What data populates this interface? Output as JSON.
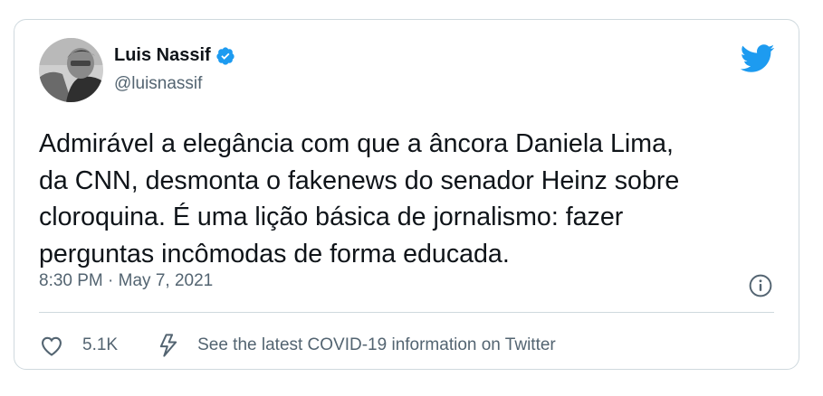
{
  "tweet": {
    "author_name": "Luis Nassif",
    "handle": "@luisnassif",
    "text": "Admirável a elegância com que a âncora Daniela Lima,\nda CNN, desmonta o fakenews do senador Heinz sobre\ncloroquina. É uma lição básica de jornalismo: fazer\nperguntas incômodas de forma educada.",
    "time": "8:30 PM",
    "separator": "·",
    "date": "May 7, 2021",
    "like_count": "5.1K",
    "covid_link": "See the latest COVID-19 information on Twitter"
  },
  "icons": {
    "verified": "verified-badge-icon",
    "brand": "twitter-bird-icon",
    "info": "info-icon",
    "like": "heart-icon",
    "covid": "lightning-icon"
  },
  "colors": {
    "brand_blue": "#1d9bf0",
    "text": "#0f1419",
    "secondary": "#536471",
    "border": "#cfd9de"
  }
}
